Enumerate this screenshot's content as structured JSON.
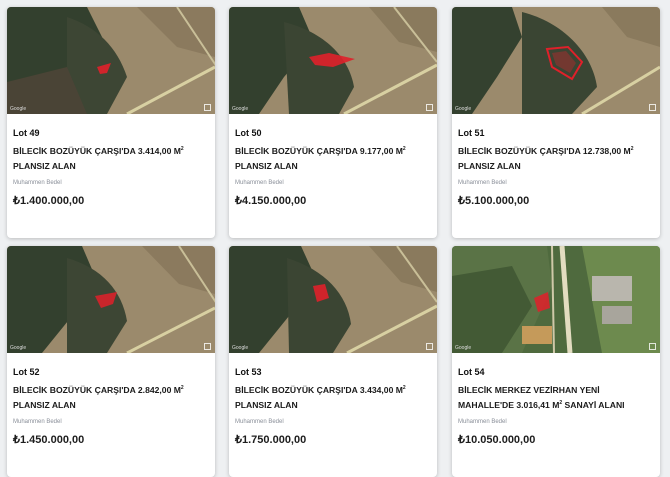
{
  "lots": [
    {
      "lot": "Lot 49",
      "title_a": "BİLECİK BOZÜYÜK ÇARŞI'DA 3.414,00 M",
      "sup": "2",
      "title_b": " PLANSIZ ALAN",
      "price_label": "Muhammen Bedel",
      "price": "₺1.400.000,00"
    },
    {
      "lot": "Lot 50",
      "title_a": "BİLECİK BOZÜYÜK ÇARŞI'DA 9.177,00 M",
      "sup": "2",
      "title_b": " PLANSIZ ALAN",
      "price_label": "Muhammen Bedel",
      "price": "₺4.150.000,00"
    },
    {
      "lot": "Lot 51",
      "title_a": "BİLECİK BOZÜYÜK ÇARŞI'DA 12.738,00 M",
      "sup": "2",
      "title_b": " PLANSIZ ALAN",
      "price_label": "Muhammen Bedel",
      "price": "₺5.100.000,00"
    },
    {
      "lot": "Lot 52",
      "title_a": "BİLECİK BOZÜYÜK ÇARŞI'DA 2.842,00 M",
      "sup": "2",
      "title_b": " PLANSIZ ALAN",
      "price_label": "Muhammen Bedel",
      "price": "₺1.450.000,00"
    },
    {
      "lot": "Lot 53",
      "title_a": "BİLECİK BOZÜYÜK ÇARŞI'DA 3.434,00 M",
      "sup": "2",
      "title_b": " PLANSIZ ALAN",
      "price_label": "Muhammen Bedel",
      "price": "₺1.750.000,00"
    },
    {
      "lot": "Lot 54",
      "title_a": "BİLECİK MERKEZ VEZİRHAN YENİ MAHALLE'DE 3.016,41 M",
      "sup": "2",
      "title_b": " SANAYİ ALANI",
      "price_label": "Muhammen Bedel",
      "price": "₺10.050.000,00"
    }
  ],
  "map_watermark": "Google",
  "colors": {
    "parcel": "#e0202a",
    "forest": "#2f3a2a",
    "field": "#9c8a6e",
    "road": "#d9d2a8"
  }
}
